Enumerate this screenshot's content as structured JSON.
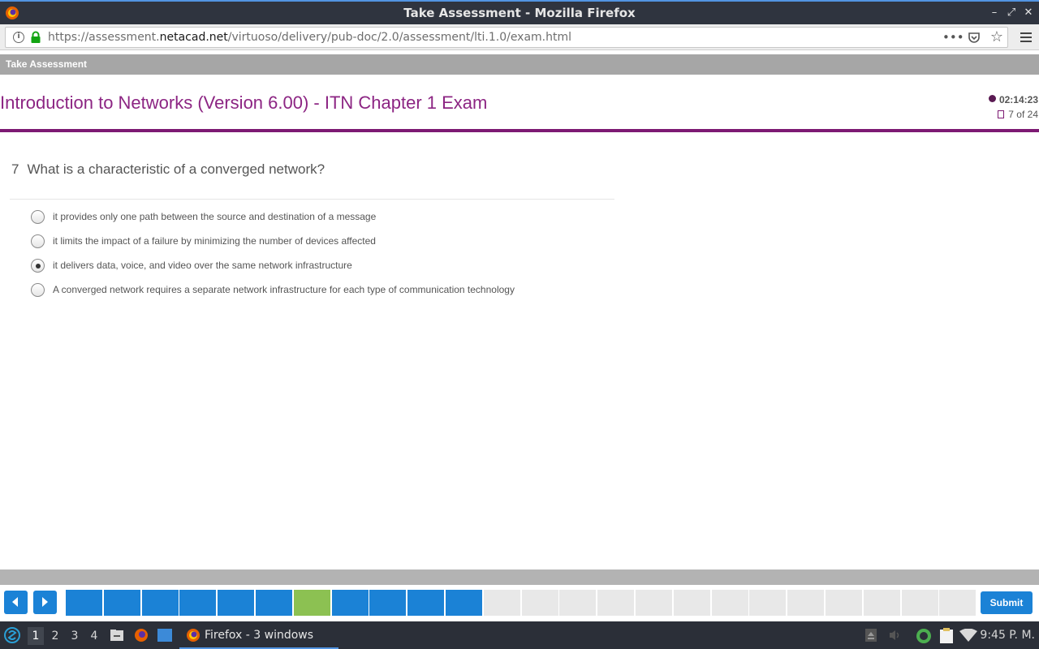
{
  "window": {
    "title": "Take Assessment - Mozilla Firefox"
  },
  "urlbar": {
    "url_prefix": "https://assessment.",
    "url_domain": "netacad.net",
    "url_path": "/virtuoso/delivery/pub-doc/2.0/assessment/lti.1.0/exam.html"
  },
  "assessment_bar": {
    "label": "Take Assessment"
  },
  "exam": {
    "title": "Introduction to Networks (Version 6.00) - ITN Chapter 1 Exam",
    "timer": "02:14:23",
    "progress": "7 of 24"
  },
  "question": {
    "number": "7",
    "text": "What is a characteristic of a converged network?",
    "options": [
      {
        "label": "it provides only one path between the source and destination of a message",
        "selected": false
      },
      {
        "label": "it limits the impact of a failure by minimizing the number of devices affected",
        "selected": false
      },
      {
        "label": "it delivers data, voice, and video over the same network infrastructure",
        "selected": true
      },
      {
        "label": "A converged network requires a separate network infrastructure for each type of communication technology",
        "selected": false
      }
    ]
  },
  "navigation": {
    "submit_label": "Submit",
    "total_questions": 24,
    "current_question": 7,
    "answered_questions": [
      1,
      2,
      3,
      4,
      5,
      6,
      7,
      8,
      9,
      10,
      11
    ],
    "colors": {
      "answered": "#1b82d6",
      "current": "#8cc152",
      "unanswered": "#e8e8e8",
      "accent": "#7d1a73"
    }
  },
  "taskbar": {
    "workspaces": [
      "1",
      "2",
      "3",
      "4"
    ],
    "active_workspace": "1",
    "task_label": "Firefox - 3 windows",
    "clock": "9:45 P. M."
  }
}
